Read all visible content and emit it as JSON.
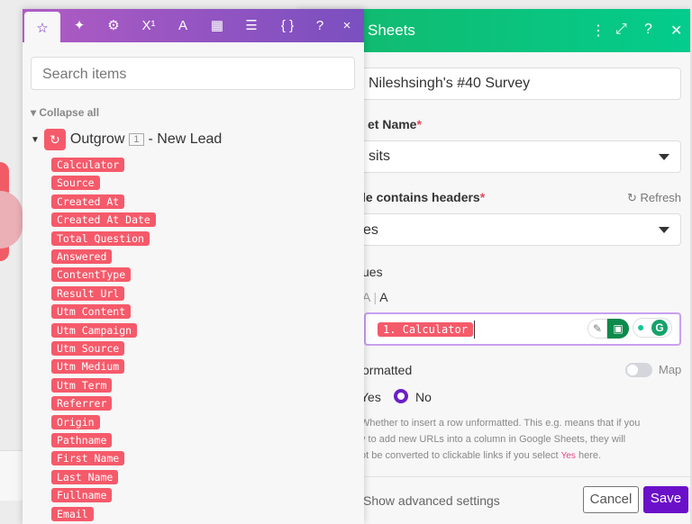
{
  "mapping_panel": {
    "tabs": [
      {
        "icon": "star-icon",
        "glyph": "☆"
      },
      {
        "icon": "sparkle-icon",
        "glyph": "✦"
      },
      {
        "icon": "gear-icon",
        "glyph": "⚙"
      },
      {
        "icon": "superscript-icon",
        "glyph": "X¹"
      },
      {
        "icon": "text-icon",
        "glyph": "A"
      },
      {
        "icon": "calendar-icon",
        "glyph": "▦"
      },
      {
        "icon": "table-icon",
        "glyph": "☰"
      },
      {
        "icon": "braces-icon",
        "glyph": "{ }"
      }
    ],
    "help": "?",
    "close": "×",
    "search_placeholder": "Search items",
    "collapse_all": "Collapse all",
    "module": {
      "name": "Outgrow",
      "badge": "1",
      "suffix": "- New Lead"
    },
    "items": [
      "Calculator",
      "Source",
      "Created At",
      "Created At Date",
      "Total Question",
      "Answered",
      "ContentType",
      "Result Url",
      "Utm Content",
      "Utm Campaign",
      "Utm Source",
      "Utm Medium",
      "Utm Term",
      "Referrer",
      "Origin",
      "Pathname",
      "First Name",
      "Last Name",
      "Fullname",
      "Email"
    ]
  },
  "sheets_panel": {
    "title": "Sheets",
    "spreadsheet_value": "Nileshsingh's #40 Survey",
    "sheet_name_label": "et Name",
    "sheet_name_value": "sits",
    "headers_label": "le contains headers",
    "refresh": "Refresh",
    "headers_value": "es",
    "values_label": "ues",
    "text_toggle_a1": "A",
    "text_toggle_a2": "A",
    "value_tag": "1. Calculator",
    "unformatted_label": "ormatted",
    "map_label": "Map",
    "radio_yes": "Yes",
    "radio_no": "No",
    "help_line1": "Whether to insert a row unformatted. This e.g. means that if you",
    "help_line2": "y to add new URLs into a column in Google Sheets, they will",
    "help_line3a": "ot be converted to clickable links if you select ",
    "help_yes": "Yes",
    "help_line3b": " here.",
    "advanced": "Show advanced settings",
    "cancel": "Cancel",
    "save": "Save",
    "required_mark": "*"
  },
  "colors": {
    "purple": "#6b1fc6",
    "green": "#0fc07e",
    "tag": "#f55a6a"
  }
}
